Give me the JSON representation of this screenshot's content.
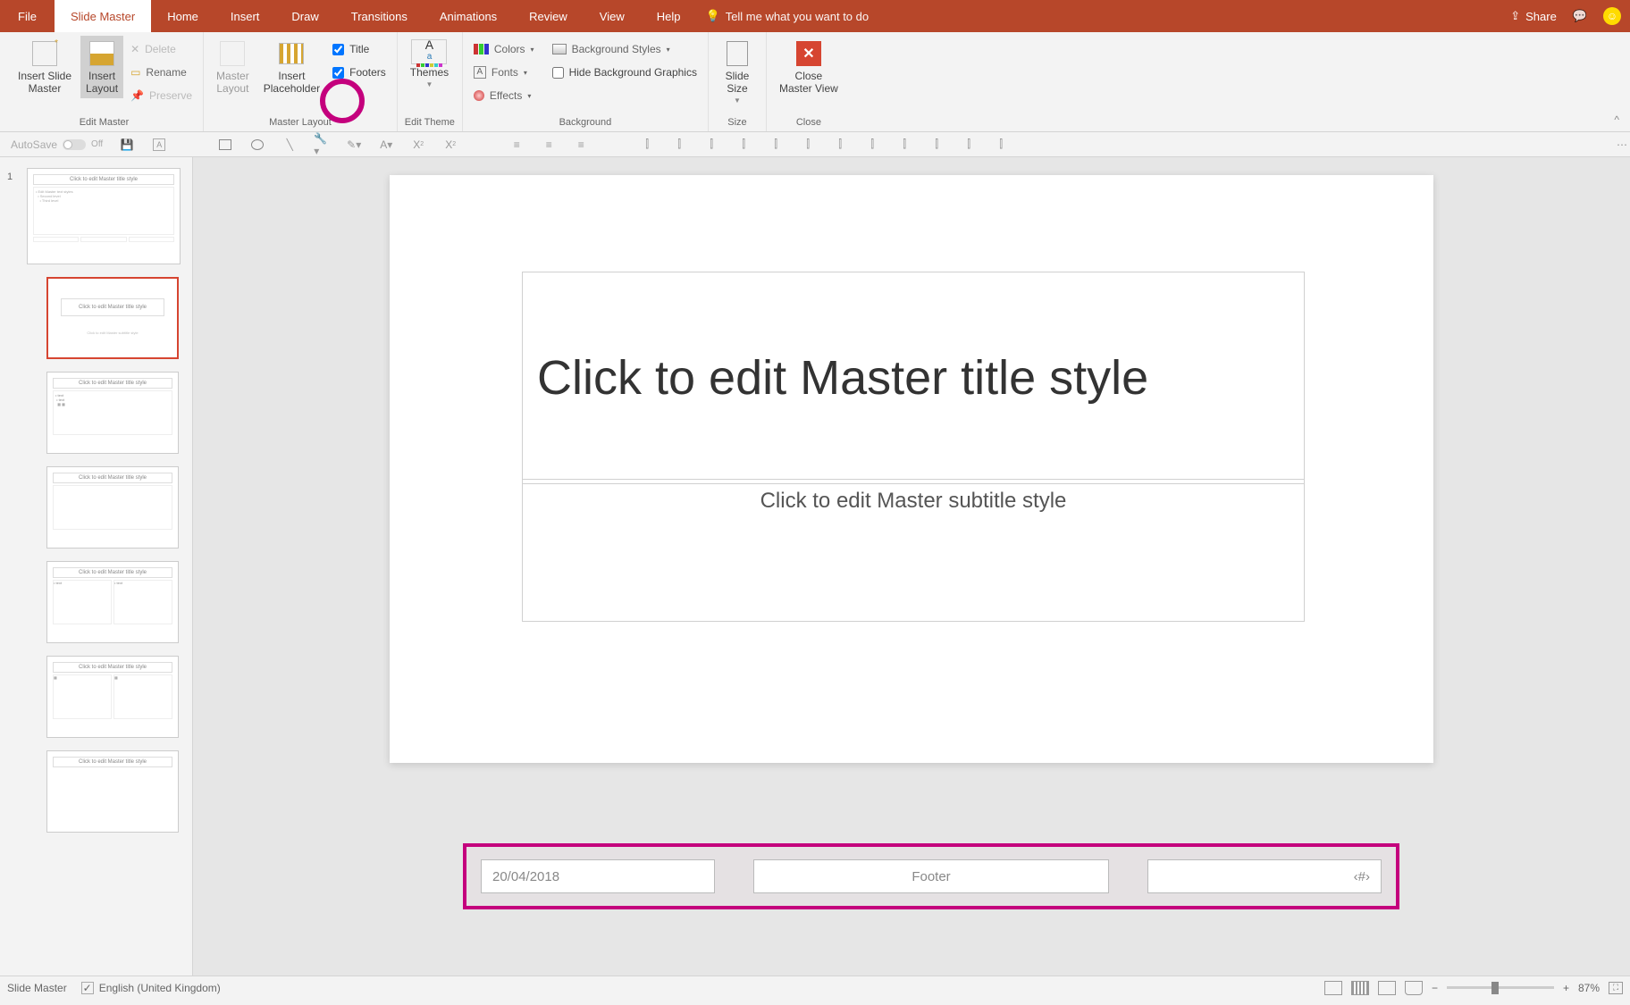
{
  "tabs": {
    "file": "File",
    "slideMaster": "Slide Master",
    "home": "Home",
    "insert": "Insert",
    "draw": "Draw",
    "transitions": "Transitions",
    "animations": "Animations",
    "review": "Review",
    "view": "View",
    "help": "Help",
    "tellMe": "Tell me what you want to do",
    "share": "Share"
  },
  "ribbon": {
    "editMaster": {
      "insertSlideMaster": "Insert Slide\nMaster",
      "insertLayout": "Insert\nLayout",
      "delete": "Delete",
      "rename": "Rename",
      "preserve": "Preserve",
      "label": "Edit Master"
    },
    "masterLayout": {
      "masterLayout": "Master\nLayout",
      "insertPlaceholder": "Insert\nPlaceholder",
      "title": "Title",
      "footers": "Footers",
      "label": "Master Layout"
    },
    "editTheme": {
      "themes": "Themes",
      "label": "Edit Theme"
    },
    "background": {
      "colors": "Colors",
      "fonts": "Fonts",
      "effects": "Effects",
      "backgroundStyles": "Background Styles",
      "hideBackgroundGraphics": "Hide Background Graphics",
      "label": "Background"
    },
    "size": {
      "slideSize": "Slide\nSize",
      "label": "Size"
    },
    "close": {
      "closeMasterView": "Close\nMaster View",
      "label": "Close"
    }
  },
  "qat": {
    "autosave": "AutoSave",
    "autosave_state": "Off"
  },
  "slide": {
    "title": "Click to edit Master title style",
    "subtitle": "Click to edit Master subtitle style",
    "thumbText": "Click to edit Master title style"
  },
  "footer": {
    "date": "20/04/2018",
    "center": "Footer",
    "num": "‹#›"
  },
  "status": {
    "mode": "Slide Master",
    "language": "English (United Kingdom)",
    "zoom": "87%"
  },
  "colors": {
    "accent": "#b7472a",
    "highlight": "#c4007d"
  }
}
